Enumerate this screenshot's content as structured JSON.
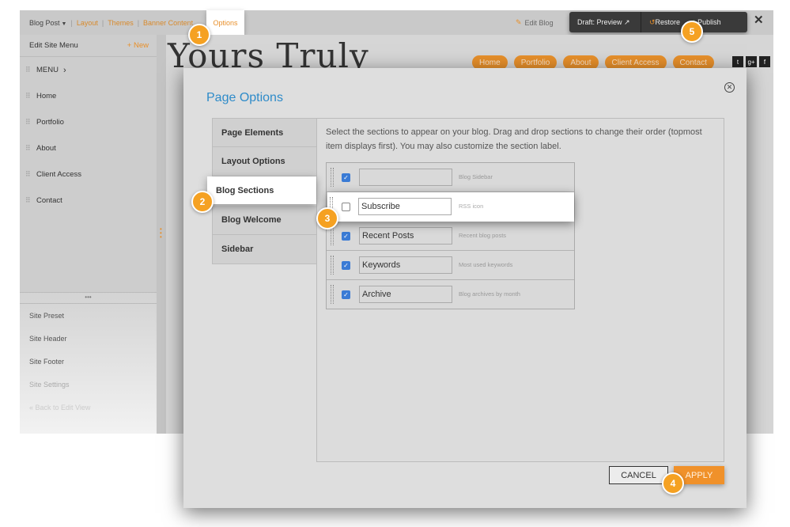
{
  "topbar": {
    "breadcrumb": "Blog Post",
    "links": [
      "Layout",
      "Themes",
      "Banner Content"
    ],
    "options_tab": "Options",
    "edit_blog": "Edit Blog",
    "draft_preview": "Draft: Preview",
    "restore": "Restore",
    "publish": "Publish"
  },
  "sidebar": {
    "title": "Edit Site Menu",
    "new_label": "New",
    "menu_header": "MENU",
    "items": [
      "Home",
      "Portfolio",
      "About",
      "Client Access",
      "Contact"
    ],
    "lower": [
      "Site Preset",
      "Site Header",
      "Site Footer",
      "Site Settings",
      "Back to Edit View"
    ]
  },
  "site": {
    "logo": "Yours Truly",
    "nav": [
      "Home",
      "Portfolio",
      "About",
      "Client Access",
      "Contact"
    ],
    "social": [
      "t",
      "g+",
      "f"
    ]
  },
  "modal": {
    "title": "Page Options",
    "description": "Select the sections to appear on your blog. Drag and drop sections to change their order (topmost item displays first). You may also customize the section label.",
    "tabs": [
      "Page Elements",
      "Layout Options",
      "Blog Sections",
      "Blog Welcome",
      "Sidebar"
    ],
    "sections": [
      {
        "label": "",
        "hint": "Blog Sidebar",
        "checked": true
      },
      {
        "label": "Subscribe",
        "hint": "RSS icon",
        "checked": false
      },
      {
        "label": "Recent Posts",
        "hint": "Recent blog posts",
        "checked": true
      },
      {
        "label": "Keywords",
        "hint": "Most used keywords",
        "checked": true
      },
      {
        "label": "Archive",
        "hint": "Blog archives by month",
        "checked": true
      }
    ],
    "cancel": "CANCEL",
    "apply": "APPLY"
  },
  "steps": [
    "1",
    "2",
    "3",
    "4",
    "5"
  ],
  "colors": {
    "accent_orange": "#e8902b",
    "title_blue": "#2e8bc9",
    "badge": "#f5a122"
  }
}
